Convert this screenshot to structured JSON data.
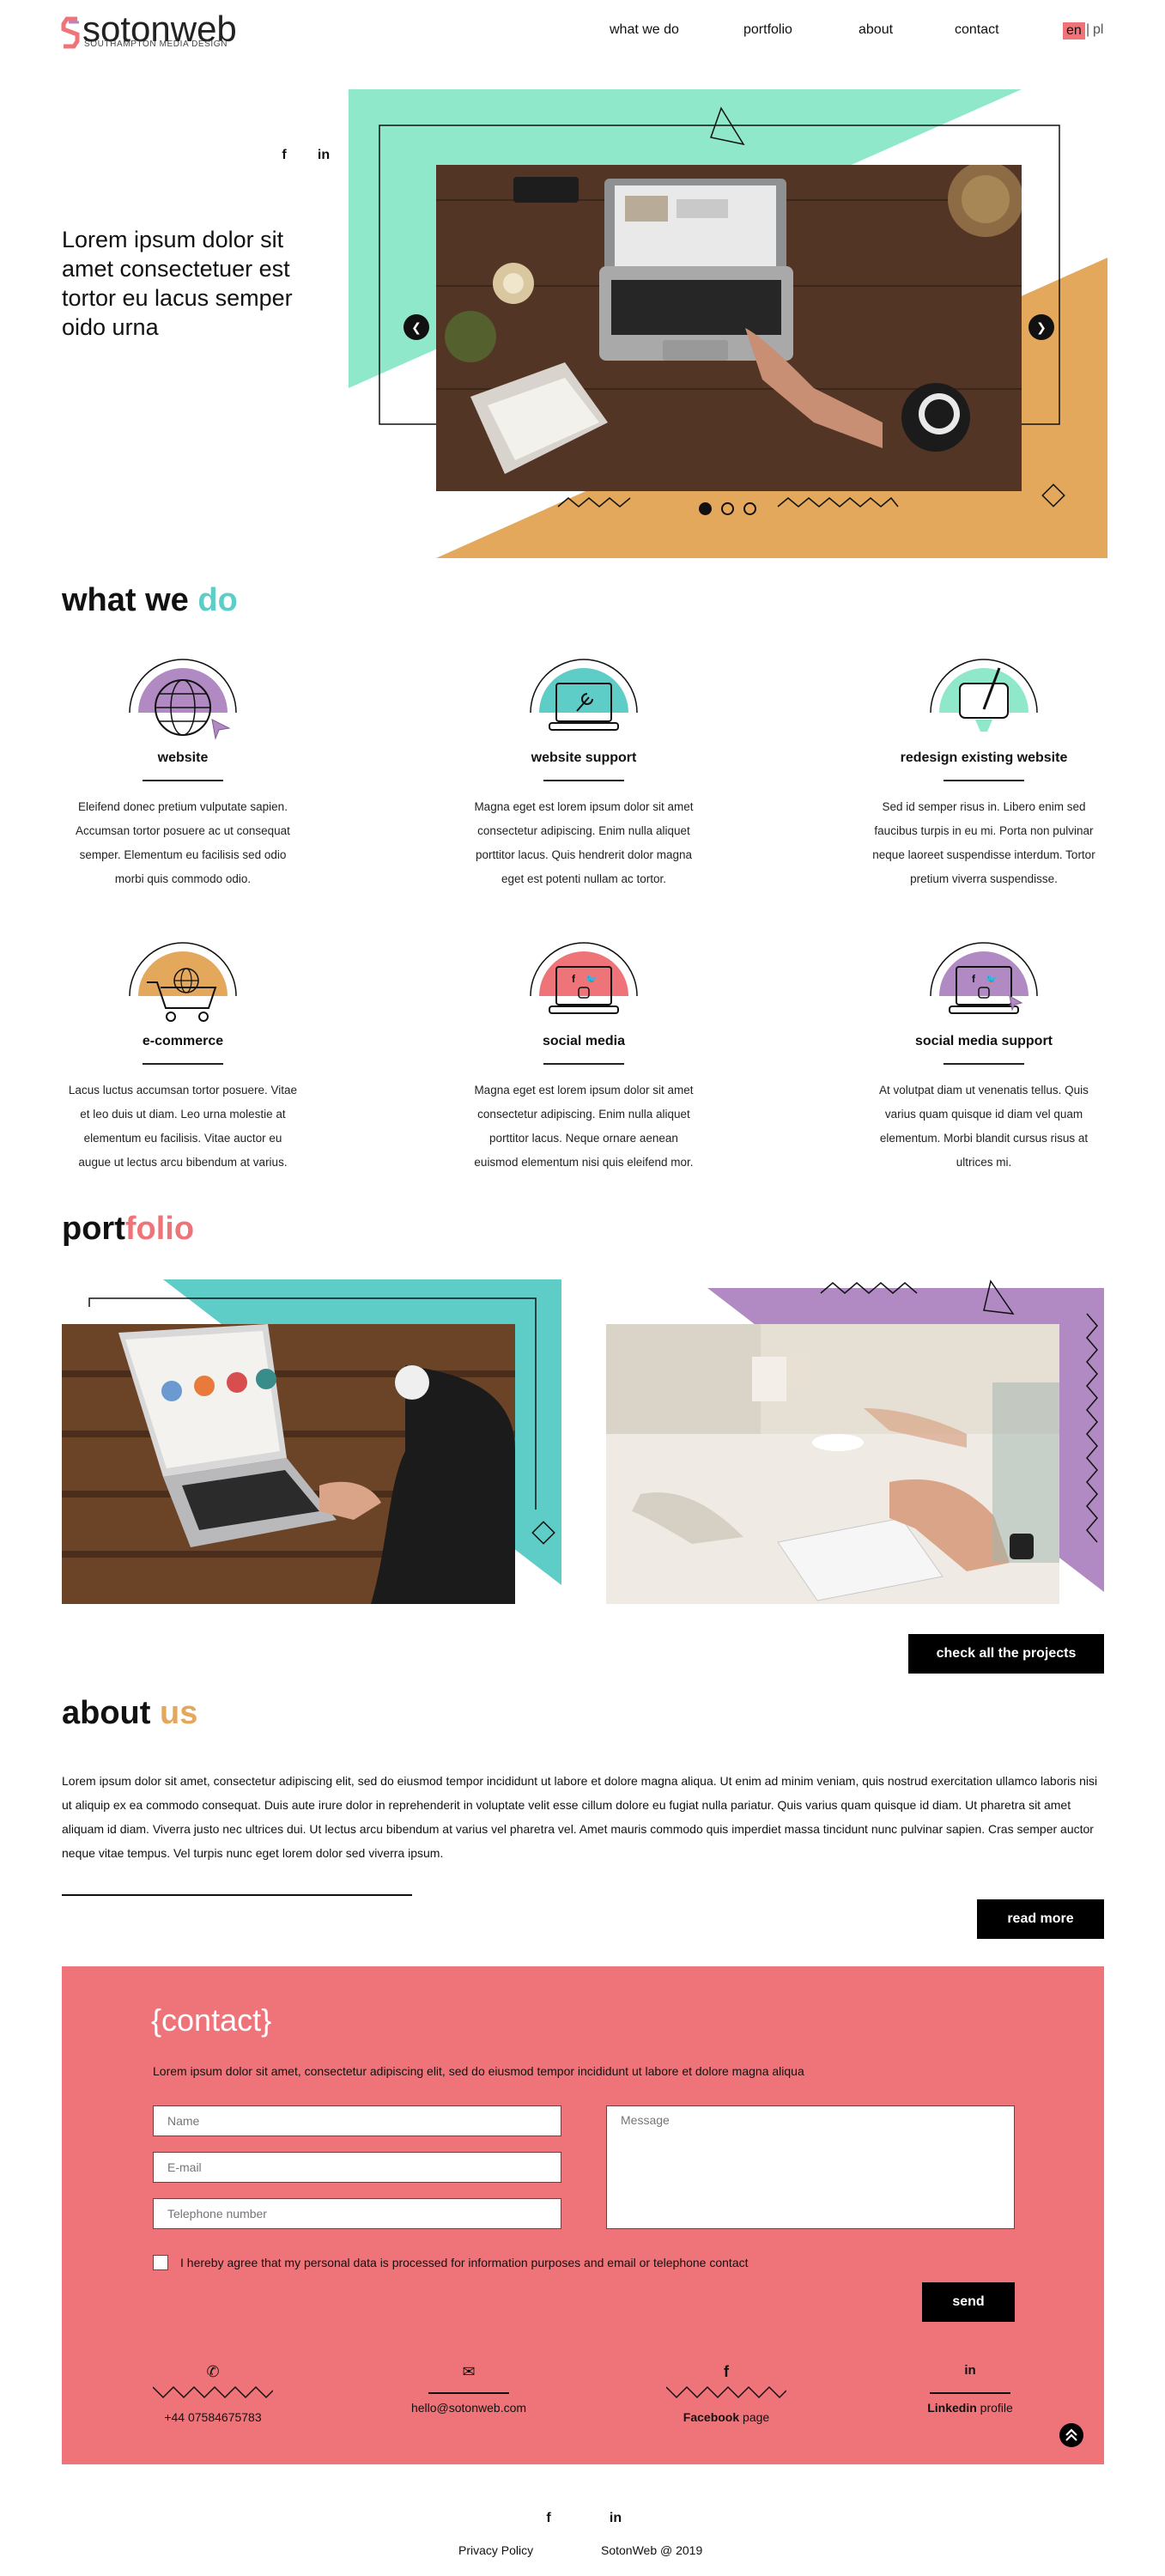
{
  "header": {
    "logo_text": "sotonweb",
    "logo_sub": "SOUTHAMPTON MEDIA DESIGN",
    "nav": [
      "what we do",
      "portfolio",
      "about",
      "contact"
    ],
    "lang_active": "en",
    "lang_sep": "|",
    "lang_other": "pl"
  },
  "hero": {
    "text": "Lorem ipsum dolor sit amet consectetuer est tortor eu lacus semper oido urna",
    "social": [
      "f",
      "in"
    ],
    "prev": "❮",
    "next": "❯",
    "slides_count": 3,
    "active_slide": 1
  },
  "what_we_do": {
    "heading_a": "what we ",
    "heading_b": "do",
    "services": [
      {
        "title": "website",
        "icon": "globe-icon",
        "color": "#b18ac3",
        "desc": "Eleifend donec pretium vulputate sapien. Accumsan tortor posuere ac ut consequat semper. Elementum eu facilisis sed odio morbi quis commodo odio."
      },
      {
        "title": "website support",
        "icon": "laptop-wrench-icon",
        "color": "#5ecdc7",
        "desc": "Magna eget est lorem ipsum dolor sit amet consectetur adipiscing. Enim nulla aliquet porttitor lacus. Quis hendrerit dolor magna eget est potenti nullam ac tortor."
      },
      {
        "title": "redesign existing website",
        "icon": "tablet-pen-icon",
        "color": "#8fe8c9",
        "desc": "Sed id semper risus in. Libero enim sed faucibus turpis in eu mi. Porta non pulvinar neque laoreet suspendisse interdum. Tortor pretium viverra suspendisse."
      },
      {
        "title": "e-commerce",
        "icon": "cart-globe-icon",
        "color": "#e3a85c",
        "desc": "Lacus luctus accumsan tortor posuere. Vitae et leo duis ut diam. Leo urna molestie at elementum eu facilisis. Vitae auctor eu augue ut lectus arcu bibendum at varius."
      },
      {
        "title": "social media",
        "icon": "laptop-social-icon",
        "color": "#ef7479",
        "desc": "Magna eget est lorem ipsum dolor sit amet consectetur adipiscing. Enim nulla aliquet porttitor lacus. Neque ornare aenean euismod elementum nisi quis eleifend mor."
      },
      {
        "title": "social media support",
        "icon": "laptop-social-support-icon",
        "color": "#b18ac3",
        "desc": "At volutpat diam ut venenatis tellus. Quis varius quam quisque id diam vel quam elementum. Morbi blandit cursus risus at ultrices mi."
      }
    ]
  },
  "portfolio": {
    "heading_a": "port",
    "heading_b": "folio",
    "button": "check all the projects"
  },
  "about": {
    "heading_a": "about ",
    "heading_b": "us",
    "text": "Lorem ipsum dolor sit amet, consectetur adipiscing elit, sed do eiusmod tempor incididunt ut labore et dolore magna aliqua. Ut enim ad minim veniam, quis nostrud exercitation ullamco laboris nisi ut aliquip ex ea commodo consequat. Duis aute irure dolor in reprehenderit in voluptate velit esse cillum dolore eu fugiat nulla pariatur. Quis varius quam quisque id diam. Ut pharetra sit amet aliquam id diam. Viverra justo nec ultrices dui. Ut lectus arcu bibendum at varius vel pharetra vel. Amet mauris commodo quis imperdiet massa tincidunt nunc pulvinar sapien. Cras semper auctor neque vitae tempus. Vel turpis nunc eget lorem dolor sed viverra ipsum.",
    "button": "read more"
  },
  "contact": {
    "heading": "{contact}",
    "intro": "Lorem ipsum dolor sit amet, consectetur adipiscing elit, sed do eiusmod tempor incididunt ut labore et dolore magna aliqua",
    "name_placeholder": "Name",
    "email_placeholder": "E-mail",
    "phone_placeholder": "Telephone number",
    "message_placeholder": "Message",
    "consent": "I hereby agree that my personal data is processed for information purposes and email or telephone contact",
    "send": "send",
    "info": [
      {
        "icon": "phone-icon",
        "glyph": "✆",
        "bold": "",
        "text": "+44 07584675783"
      },
      {
        "icon": "mail-icon",
        "glyph": "✉",
        "bold": "",
        "text": "hello@sotonweb.com"
      },
      {
        "icon": "facebook-icon",
        "glyph": "f",
        "bold": "Facebook",
        "text": " page"
      },
      {
        "icon": "linkedin-icon",
        "glyph": "in",
        "bold": "Linkedin",
        "text": " profile"
      }
    ]
  },
  "footer": {
    "social": [
      "f",
      "in"
    ],
    "privacy": "Privacy Policy",
    "copyright": "SotonWeb @ 2019"
  },
  "colors": {
    "teal": "#5ecdc7",
    "mint": "#8fe8c9",
    "gold": "#e3a85c",
    "pink": "#ef7479",
    "purple": "#b18ac3"
  }
}
